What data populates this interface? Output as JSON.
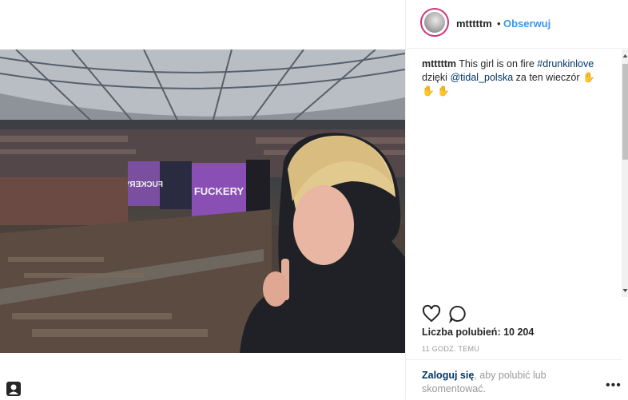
{
  "post": {
    "username": "mtttttm",
    "separator": "•",
    "follow_label": "Obserwuj",
    "caption_user": "mtttttm",
    "caption_text_1": "This girl is on fire",
    "hashtag": "#drunkinlove",
    "caption_text_2": "dzięki",
    "mention": "@tidal_polska",
    "caption_text_3": "za ten wieczór",
    "emoji": "✋✋",
    "emoji_2": "✋",
    "likes_label": "Liczba polubień: 10 204",
    "time_label": "11 GODZ. TEMU"
  },
  "photo": {
    "screen_left_text": "FUCKERY",
    "screen_right_text": "FUCKERY"
  },
  "login": {
    "link_label": "Zaloguj się",
    "rest_label": ", aby polubić lub skomentować."
  },
  "icons": {
    "like": "heart-icon",
    "comment": "comment-icon",
    "more": "more-options-icon",
    "corner": "user-tag-icon"
  },
  "colors": {
    "link": "#003569",
    "follow": "#3897f0",
    "avatar_ring": "#c8357a"
  }
}
